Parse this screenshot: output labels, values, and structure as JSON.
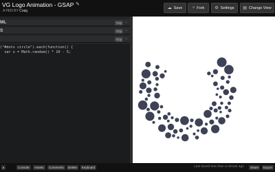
{
  "header": {
    "title": "VG Logo Animation - GSAP",
    "author_prefix": "A PEN BY",
    "author": "Craig",
    "buttons": {
      "save": "Save",
      "fork": "Fork",
      "settings": "Settings",
      "change_view": "Change View"
    }
  },
  "editor": {
    "panels": {
      "html": "ML",
      "css": "S",
      "js": ""
    },
    "tidy_label": "Tidy",
    "js_lines": [
      "(\"#dots circle\").each(function() {",
      "  var x = Math.random() * 10 - 5;"
    ]
  },
  "preview": {
    "dot_color": "#3d4256",
    "background": "#ffffff"
  },
  "footer": {
    "buttons": [
      "Console",
      "Assets",
      "Comments",
      "Delete",
      "Keyboard"
    ],
    "status": "Last saved less than a minute ago",
    "share": "Share",
    "export": "Export"
  },
  "colors": {
    "header_bg": "#111111",
    "editor_bg": "#1b1c1d",
    "dot": "#3d4256"
  }
}
